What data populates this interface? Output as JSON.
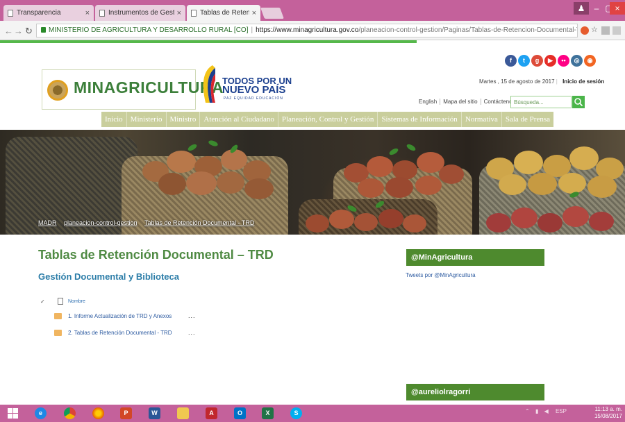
{
  "browser": {
    "tabs": [
      {
        "label": "Transparencia",
        "close": "×"
      },
      {
        "label": "Instrumentos de Gestión",
        "close": "×"
      },
      {
        "label": "Tablas de Retención Doc",
        "close": "×"
      }
    ],
    "address": {
      "site_name": "MINISTERIO DE AGRICULTURA Y DESARROLLO RURAL [CO]",
      "url_host": "https://www.minagricultura.gov.co",
      "url_path": "/planeacion-control-gestion/Paginas/Tablas-de-Retencion-Documental-TRD.a..."
    },
    "window_controls": {
      "minimize": "–",
      "maximize": "▢",
      "close": "×"
    }
  },
  "header": {
    "logo_text": "MINAGRICULTURA",
    "campaign_line1": "TODOS POR UN",
    "campaign_line2": "NUEVO PAÍS",
    "campaign_line3": "PAZ EQUIDAD EDUCACIÓN",
    "date": "Martes , 15 de agosto de 2017",
    "login": "Inicio de sesión",
    "top_links": [
      "English",
      "Mapa del sitio",
      "Contáctenos"
    ],
    "search_placeholder": "Búsqueda..."
  },
  "social": [
    {
      "name": "facebook-icon",
      "glyph": "f",
      "color": "#3b5998"
    },
    {
      "name": "twitter-icon",
      "glyph": "t",
      "color": "#1da1f2"
    },
    {
      "name": "google-plus-icon",
      "glyph": "g",
      "color": "#dd4b39"
    },
    {
      "name": "youtube-icon",
      "glyph": "▶",
      "color": "#e52d27"
    },
    {
      "name": "flickr-icon",
      "glyph": "••",
      "color": "#ff0084"
    },
    {
      "name": "instagram-icon",
      "glyph": "◎",
      "color": "#3f729b"
    },
    {
      "name": "rss-icon",
      "glyph": "◉",
      "color": "#f26522"
    }
  ],
  "nav": [
    "Inicio",
    "Ministerio",
    "Ministro",
    "Atención al Ciudadano",
    "Planeación, Control y Gestión",
    "Sistemas de Información",
    "Normativa",
    "Sala de Prensa"
  ],
  "breadcrumb": [
    "MADR",
    "planeacion-control-gestion",
    "Tablas de Retención Documental - TRD"
  ],
  "content": {
    "title": "Tablas de Retención Documental – TRD",
    "subtitle": "Gestión Documental y Biblioteca",
    "list_header": "Nombre",
    "items": [
      "1. Informe Actualización de TRD y Anexos",
      "2. Tablas de Retención Documental - TRD"
    ],
    "item_menu": "..."
  },
  "sidebar": {
    "twitter_title": "@MinAgricultura",
    "twitter_sub": "Tweets por @MinAgricultura",
    "twitter_title2": "@aureliolragorri"
  },
  "taskbar": {
    "tray": "ESP",
    "time": "11:13 a. m.",
    "date": "15/08/2017"
  }
}
